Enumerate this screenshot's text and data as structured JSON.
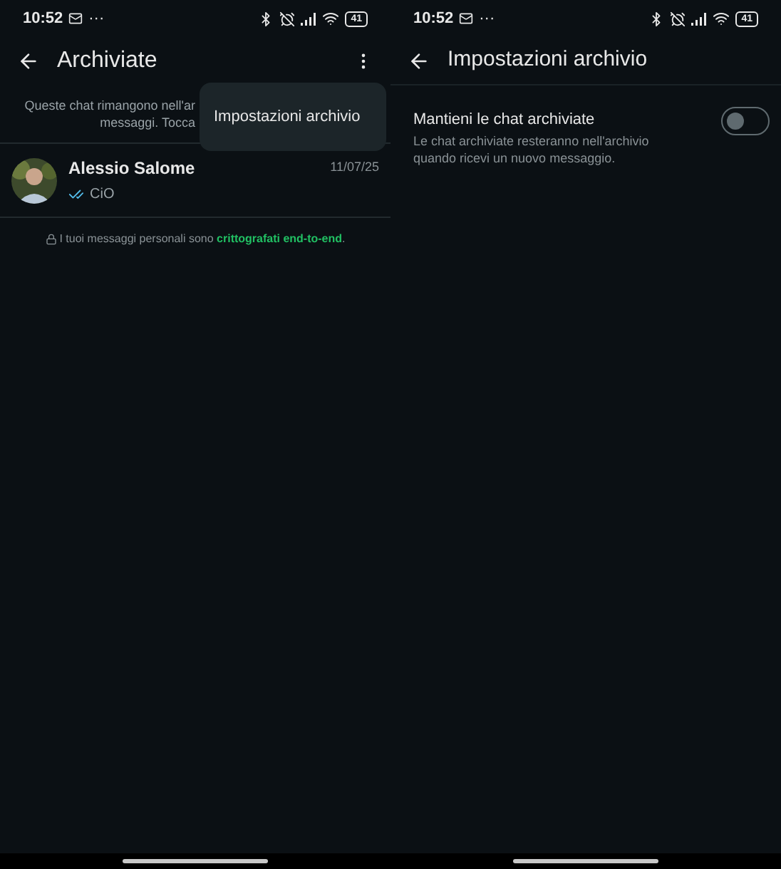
{
  "screens": [
    {
      "status_bar": {
        "time": "10:52",
        "dots": "···",
        "battery": "41"
      },
      "header": {
        "title": "Archiviate"
      },
      "info_lines": [
        "Queste chat rimangono nell'ar",
        "messaggi. Tocca"
      ],
      "menu": {
        "items": [
          "Impostazioni archivio"
        ]
      },
      "chats": [
        {
          "name": "Alessio Salome",
          "date": "11/07/25",
          "message": "CiO",
          "read": true
        }
      ],
      "encryption_notice": "I tuoi messaggi personali sono **crittografati end-to-end**."
    },
    {
      "status_bar": {
        "time": "10:52",
        "dots": "···",
        "battery": "41"
      },
      "header": {
        "title": "Impostazioni archivio"
      },
      "settings": [
        {
          "title": "Mantieni le chat archiviate",
          "description": "Le chat archiviate resteranno nell'archivio quando ricevi un nuovo messaggio.",
          "on": false
        }
      ]
    }
  ]
}
